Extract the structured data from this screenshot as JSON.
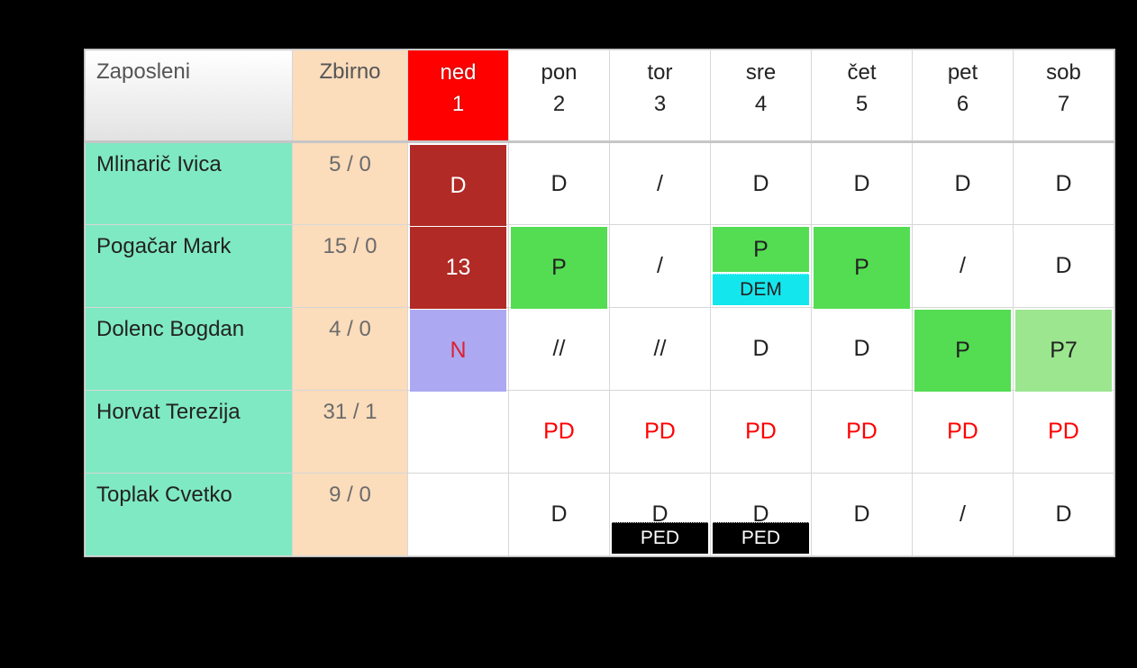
{
  "header": {
    "employees_label": "Zaposleni",
    "summary_label": "Zbirno",
    "days": [
      {
        "name": "ned",
        "num": "1",
        "sunday": true
      },
      {
        "name": "pon",
        "num": "2",
        "sunday": false
      },
      {
        "name": "tor",
        "num": "3",
        "sunday": false
      },
      {
        "name": "sre",
        "num": "4",
        "sunday": false
      },
      {
        "name": "čet",
        "num": "5",
        "sunday": false
      },
      {
        "name": "pet",
        "num": "6",
        "sunday": false
      },
      {
        "name": "sob",
        "num": "7",
        "sunday": false
      }
    ]
  },
  "rows": [
    {
      "name": "Mlinarič Ivica",
      "summary": "5 / 0",
      "cells": [
        {
          "main": "D",
          "main_bg": "bg-darkred"
        },
        {
          "main": "D"
        },
        {
          "main": "/"
        },
        {
          "main": "D"
        },
        {
          "main": "D"
        },
        {
          "main": "D"
        },
        {
          "main": "D"
        }
      ]
    },
    {
      "name": "Pogačar Mark",
      "summary": "15 / 0",
      "cells": [
        {
          "main": "13",
          "main_bg": "bg-darkred"
        },
        {
          "main": "P",
          "main_bg": "bg-green"
        },
        {
          "main": "/"
        },
        {
          "main": "P",
          "main_bg": "bg-green",
          "sub": "DEM",
          "sub_bg": "bg-cyan"
        },
        {
          "main": "P",
          "main_bg": "bg-green"
        },
        {
          "main": "/"
        },
        {
          "main": "D"
        }
      ]
    },
    {
      "name": "Dolenc Bogdan",
      "summary": "4 / 0",
      "cells": [
        {
          "main": "N",
          "main_bg": "bg-lav"
        },
        {
          "main": "//"
        },
        {
          "main": "//"
        },
        {
          "main": "D"
        },
        {
          "main": "D"
        },
        {
          "main": "P",
          "main_bg": "bg-green"
        },
        {
          "main": "P7",
          "main_bg": "bg-lgreen"
        }
      ]
    },
    {
      "name": "Horvat Terezija",
      "summary": "31 / 1",
      "cells": [
        {
          "main": ""
        },
        {
          "main": "PD",
          "main_txt": "txt-red"
        },
        {
          "main": "PD",
          "main_txt": "txt-red"
        },
        {
          "main": "PD",
          "main_txt": "txt-red"
        },
        {
          "main": "PD",
          "main_txt": "txt-red"
        },
        {
          "main": "PD",
          "main_txt": "txt-red"
        },
        {
          "main": "PD",
          "main_txt": "txt-red"
        }
      ]
    },
    {
      "name": "Toplak Cvetko",
      "summary": "9 / 0",
      "cells": [
        {
          "main": ""
        },
        {
          "main": "D"
        },
        {
          "main": "D",
          "sub": "PED",
          "sub_bg": "bg-black"
        },
        {
          "main": "D",
          "sub": "PED",
          "sub_bg": "bg-black"
        },
        {
          "main": "D"
        },
        {
          "main": "/"
        },
        {
          "main": "D"
        }
      ]
    }
  ]
}
